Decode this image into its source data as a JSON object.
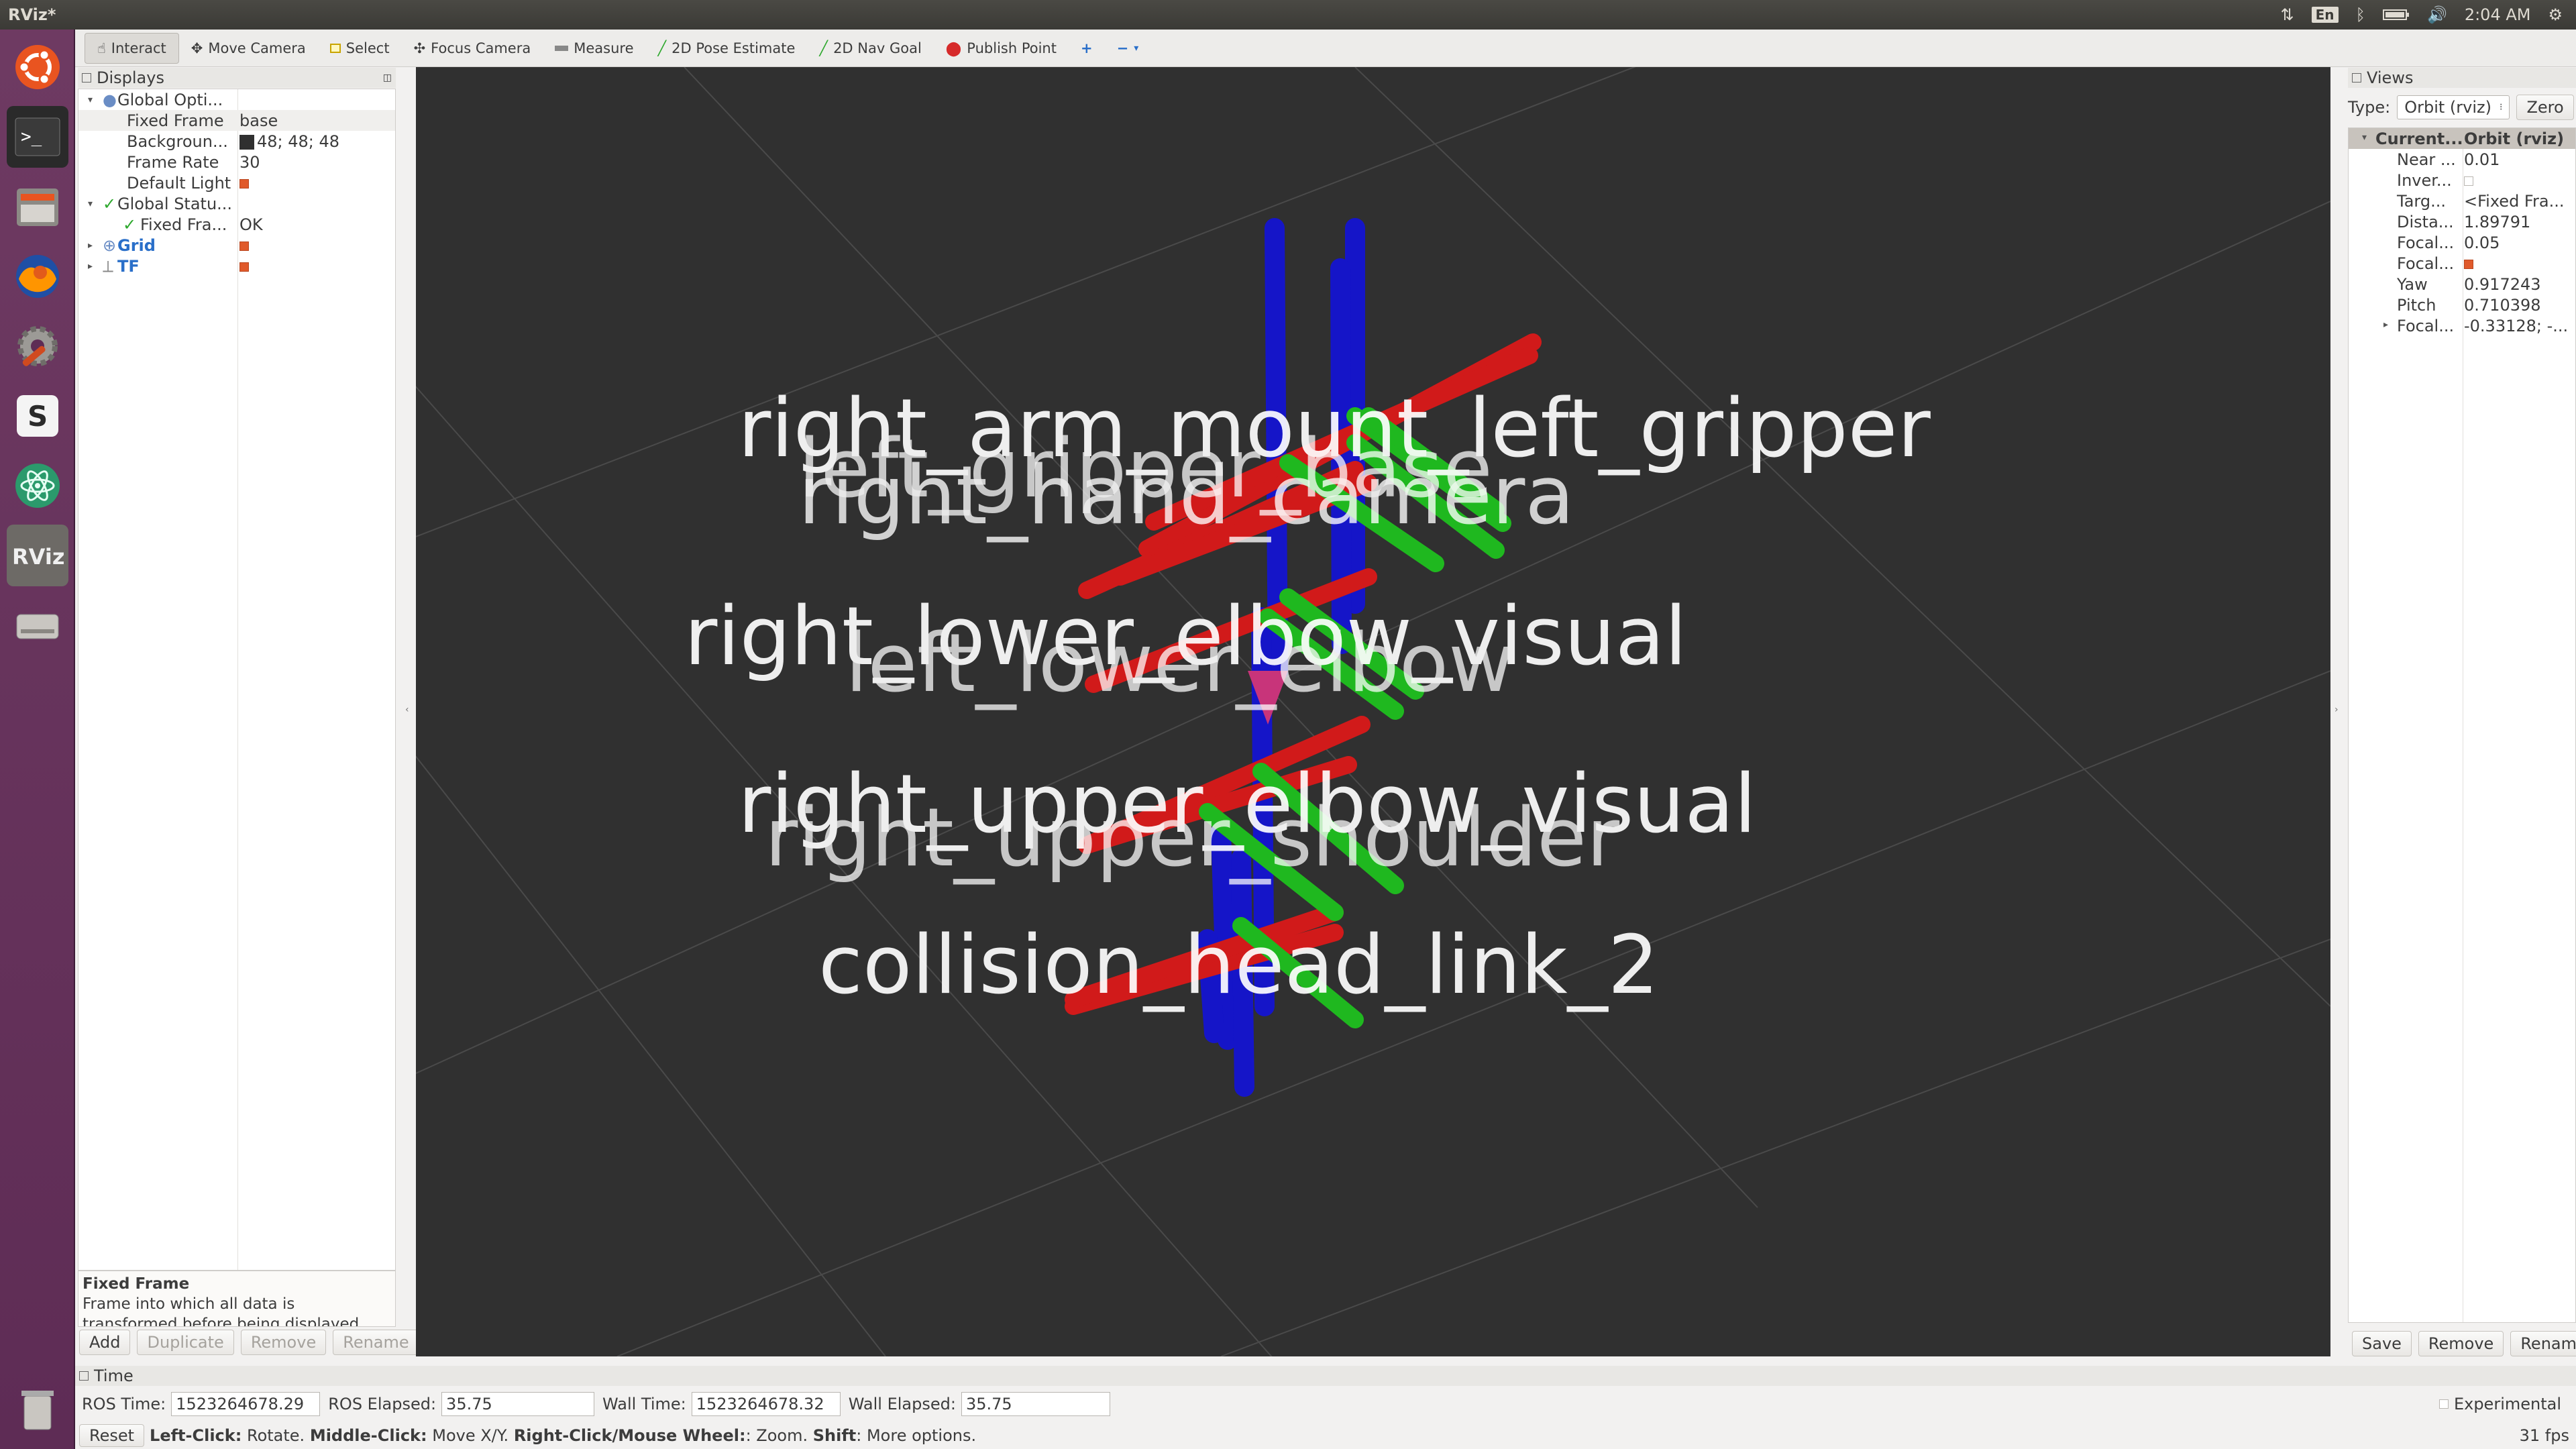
{
  "window_title": "RViz*",
  "tray": {
    "lang": "En",
    "clock": "2:04 AM"
  },
  "toolbar": {
    "interact": "Interact",
    "move_camera": "Move Camera",
    "select": "Select",
    "focus_camera": "Focus Camera",
    "measure": "Measure",
    "pose_estimate": "2D Pose Estimate",
    "nav_goal": "2D Nav Goal",
    "publish_point": "Publish Point",
    "plus": "+",
    "minus": "−"
  },
  "displays": {
    "title": "Displays",
    "rows": [
      {
        "key": "Global Opti...",
        "value": ""
      },
      {
        "key": "Fixed Frame",
        "value": "base"
      },
      {
        "key": "Backgroun...",
        "value": "48; 48; 48"
      },
      {
        "key": "Frame Rate",
        "value": "30"
      },
      {
        "key": "Default Light",
        "value": ""
      },
      {
        "key": "Global Statu...",
        "value": ""
      },
      {
        "key": "Fixed Fra...",
        "value": "OK"
      },
      {
        "key": "Grid",
        "value": ""
      },
      {
        "key": "TF",
        "value": ""
      }
    ],
    "help_title": "Fixed Frame",
    "help_text": "Frame into which all data is transformed before being displayed.",
    "buttons": {
      "add": "Add",
      "duplicate": "Duplicate",
      "remove": "Remove",
      "rename": "Rename"
    }
  },
  "viewport": {
    "background": "#303030",
    "labels": [
      "right_arm_mount_left_gripper",
      "left_gripper_base",
      "right_hand_camera",
      "right_lower_elbow_visual",
      "left_lower_elbow",
      "right_upper_elbow_visual",
      "right_upper_shoulder",
      "collision_head_link_2"
    ]
  },
  "views": {
    "title": "Views",
    "type_label": "Type:",
    "type_value": "Orbit (rviz)",
    "zero": "Zero",
    "header_key": "Current...",
    "header_value": "Orbit (rviz)",
    "rows": [
      {
        "key": "Near ...",
        "value": "0.01"
      },
      {
        "key": "Inver...",
        "value": ""
      },
      {
        "key": "Targ...",
        "value": "<Fixed Fra..."
      },
      {
        "key": "Dista...",
        "value": "1.89791"
      },
      {
        "key": "Focal...",
        "value": "0.05"
      },
      {
        "key": "Focal...",
        "value": ""
      },
      {
        "key": "Yaw",
        "value": "0.917243"
      },
      {
        "key": "Pitch",
        "value": "0.710398"
      },
      {
        "key": "Focal...",
        "value": "-0.33128; -..."
      }
    ],
    "buttons": {
      "save": "Save",
      "remove": "Remove",
      "rename": "Rename"
    }
  },
  "time": {
    "title": "Time",
    "ros_time_label": "ROS Time:",
    "ros_time": "1523264678.29",
    "ros_elapsed_label": "ROS Elapsed:",
    "ros_elapsed": "35.75",
    "wall_time_label": "Wall Time:",
    "wall_time": "1523264678.32",
    "wall_elapsed_label": "Wall Elapsed:",
    "wall_elapsed": "35.75",
    "experimental": "Experimental"
  },
  "status": {
    "reset": "Reset",
    "b1": "Left-Click:",
    "t1": " Rotate. ",
    "b2": "Middle-Click:",
    "t2": " Move X/Y. ",
    "b3": "Right-Click/Mouse Wheel:",
    "t3": ": Zoom. ",
    "b4": "Shift",
    "t4": ": More options.",
    "fps": "31 fps"
  }
}
